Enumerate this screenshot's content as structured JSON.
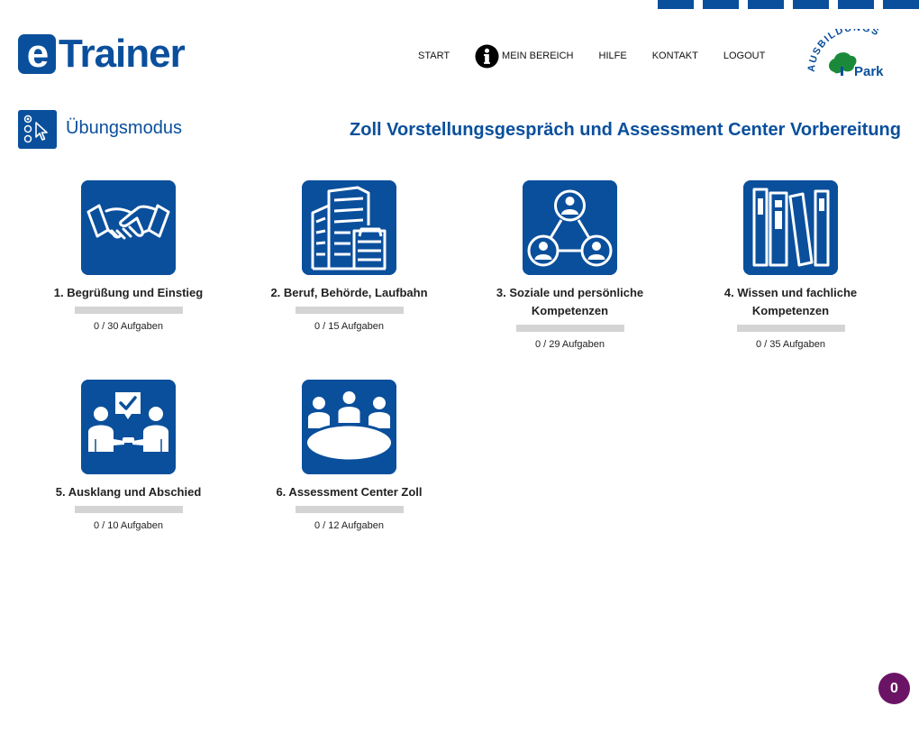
{
  "header": {
    "logo_e": "e",
    "logo_text": "Trainer",
    "nav": [
      {
        "label": "START"
      },
      {
        "label": "MEIN BEREICH",
        "icon": "info-icon"
      },
      {
        "label": "HILFE"
      },
      {
        "label": "KONTAKT"
      },
      {
        "label": "LOGOUT"
      }
    ],
    "partner_logo": {
      "arc_text": "AUSBILDUNGS",
      "sub_text": "Park"
    },
    "top_squares": 6
  },
  "page": {
    "mode_icon": "pointer-select-icon",
    "mode_title": "Übungsmodus",
    "course_title": "Zoll Vorstellungsgespräch und Assessment Center Vorbereitung"
  },
  "categories": [
    {
      "label": "1. Begrüßung und Einstieg",
      "count": "0 / 30 Aufgaben",
      "progress": 0,
      "icon": "handshake-icon"
    },
    {
      "label": "2. Beruf, Behörde, Laufbahn",
      "count": "0 / 15 Aufgaben",
      "progress": 0,
      "icon": "buildings-icon"
    },
    {
      "label": "3. Soziale und persönliche Kompetenzen",
      "count": "0 / 29 Aufgaben",
      "progress": 0,
      "icon": "people-network-icon"
    },
    {
      "label": "4. Wissen und fachliche Kompetenzen",
      "count": "0 / 35 Aufgaben",
      "progress": 0,
      "icon": "books-icon"
    },
    {
      "label": "5. Ausklang und Abschied",
      "count": "0 / 10 Aufgaben",
      "progress": 0,
      "icon": "agreement-meeting-icon"
    },
    {
      "label": "6. Assessment Center Zoll",
      "count": "0 / 12 Aufgaben",
      "progress": 0,
      "icon": "conference-table-icon"
    }
  ],
  "badge": {
    "value": "0"
  },
  "colors": {
    "primary": "#0a4f9c",
    "badge": "#6b1466",
    "progress_track": "#d4d4d4",
    "partner_green": "#1a8a3a"
  }
}
